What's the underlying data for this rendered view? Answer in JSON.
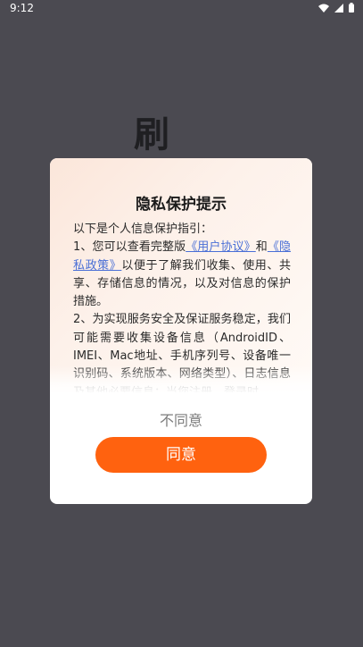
{
  "status_bar": {
    "time": "9:12",
    "icons": [
      "wifi-icon",
      "signal-icon",
      "battery-icon"
    ]
  },
  "splash": {
    "char": "刷"
  },
  "dialog": {
    "title": "隐私保护提示",
    "body": {
      "intro": "以下是个人信息保护指引：",
      "item1_prefix": "1、您可以查看完整版",
      "user_agreement_link": "《用户协议》",
      "item1_and": "和",
      "privacy_policy_link": "《隐私政策》",
      "item1_suffix": "以便于了解我们收集、使用、共享、存储信息的情况，以及对信息的保护措施。",
      "item2": "2、为实现服务安全及保证服务稳定，我们可能需要收集设备信息（AndroidID、IMEI、Mac地址、手机序列号、设备唯一识别码、系统版本、网络类型）、日志信息及其他必要信息；当您注册、登录时，"
    },
    "disagree_label": "不同意",
    "agree_label": "同意"
  },
  "colors": {
    "background": "#4b4a51",
    "accent": "#ff620f",
    "link": "#4a6fd6"
  }
}
